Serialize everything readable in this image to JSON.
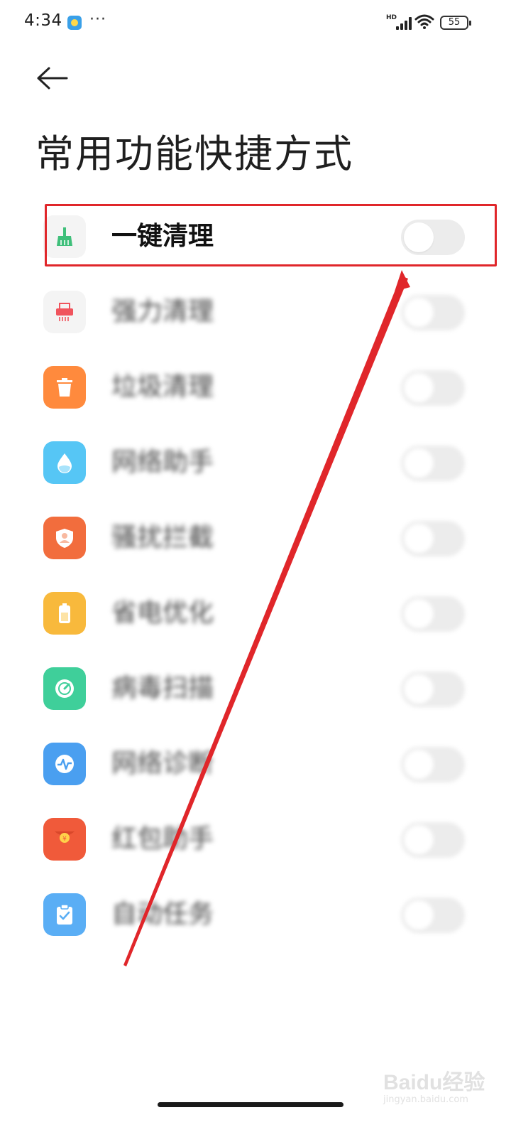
{
  "status_bar": {
    "time": "4:34",
    "more": "···",
    "network": "HD",
    "battery": "55"
  },
  "page": {
    "title": "常用功能快捷方式"
  },
  "shortcuts": [
    {
      "label": "一键清理",
      "icon": "broom-icon",
      "icon_bg": "#f4f4f4",
      "icon_color": "#3fbf7a",
      "enabled": false
    },
    {
      "label": "强力清理",
      "icon": "shredder-icon",
      "icon_bg": "#f4f4f4",
      "icon_color": "#f0545d",
      "enabled": false
    },
    {
      "label": "垃圾清理",
      "icon": "trash-icon",
      "icon_bg": "#ff8a3d",
      "icon_color": "#ffffff",
      "enabled": false
    },
    {
      "label": "网络助手",
      "icon": "water-drop-icon",
      "icon_bg": "#56c6f5",
      "icon_color": "#ffffff",
      "enabled": false
    },
    {
      "label": "骚扰拦截",
      "icon": "shield-user-icon",
      "icon_bg": "#f26d3d",
      "icon_color": "#ffffff",
      "enabled": false
    },
    {
      "label": "省电优化",
      "icon": "battery-icon",
      "icon_bg": "#f8b93c",
      "icon_color": "#ffffff",
      "enabled": false
    },
    {
      "label": "病毒扫描",
      "icon": "scan-gauge-icon",
      "icon_bg": "#3fcf9a",
      "icon_color": "#ffffff",
      "enabled": false
    },
    {
      "label": "网络诊断",
      "icon": "pulse-icon",
      "icon_bg": "#4a9ff0",
      "icon_color": "#ffffff",
      "enabled": false
    },
    {
      "label": "红包助手",
      "icon": "red-envelope-icon",
      "icon_bg": "#f05a3a",
      "icon_color": "#ffd24a",
      "enabled": false
    },
    {
      "label": "自动任务",
      "icon": "clipboard-check-icon",
      "icon_bg": "#5aaef5",
      "icon_color": "#ffffff",
      "enabled": false
    }
  ],
  "colors": {
    "highlight": "#e0262a",
    "toggle_off": "#ececec"
  },
  "watermark": {
    "logo": "Baidu经验",
    "url": "jingyan.baidu.com"
  }
}
